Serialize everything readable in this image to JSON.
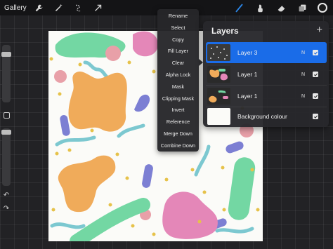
{
  "topbar": {
    "gallery_label": "Gallery",
    "left_tools": [
      "wrench-icon",
      "magic-wand-icon",
      "selection-icon",
      "move-arrow-icon"
    ],
    "right_tools": [
      "brush-icon",
      "smudge-icon",
      "eraser-icon",
      "layers-icon",
      "color-icon"
    ],
    "active_tool": "brush-icon",
    "active_color": "#2b86e8"
  },
  "actions_menu": {
    "items": [
      "Rename",
      "Select",
      "Copy",
      "Fill Layer",
      "Clear",
      "Alpha Lock",
      "Mask",
      "Clipping Mask",
      "Invert",
      "Reference",
      "Merge Down",
      "Combine Down"
    ]
  },
  "layers_panel": {
    "title": "Layers",
    "add_label": "+",
    "layers": [
      {
        "name": "Layer 3",
        "mode": "N",
        "visible": true,
        "selected": true
      },
      {
        "name": "Layer 1",
        "mode": "N",
        "visible": true,
        "selected": false
      },
      {
        "name": "Layer 1",
        "mode": "N",
        "visible": true,
        "selected": false
      },
      {
        "name": "Background colour",
        "mode": "",
        "visible": true,
        "selected": false
      }
    ]
  },
  "sidebar": {
    "undo_label": "↶",
    "redo_label": "↷"
  },
  "palette": {
    "orange": "#f0ab5a",
    "green": "#73d7a3",
    "pink": "#e487b8",
    "purple": "#7c7fd3",
    "teal": "#7cc8d0",
    "rose": "#e8a0a8",
    "dot": "#e6c24a",
    "canvas_bg": "#fbfbf8",
    "selection_blue": "#1a6ce8"
  }
}
